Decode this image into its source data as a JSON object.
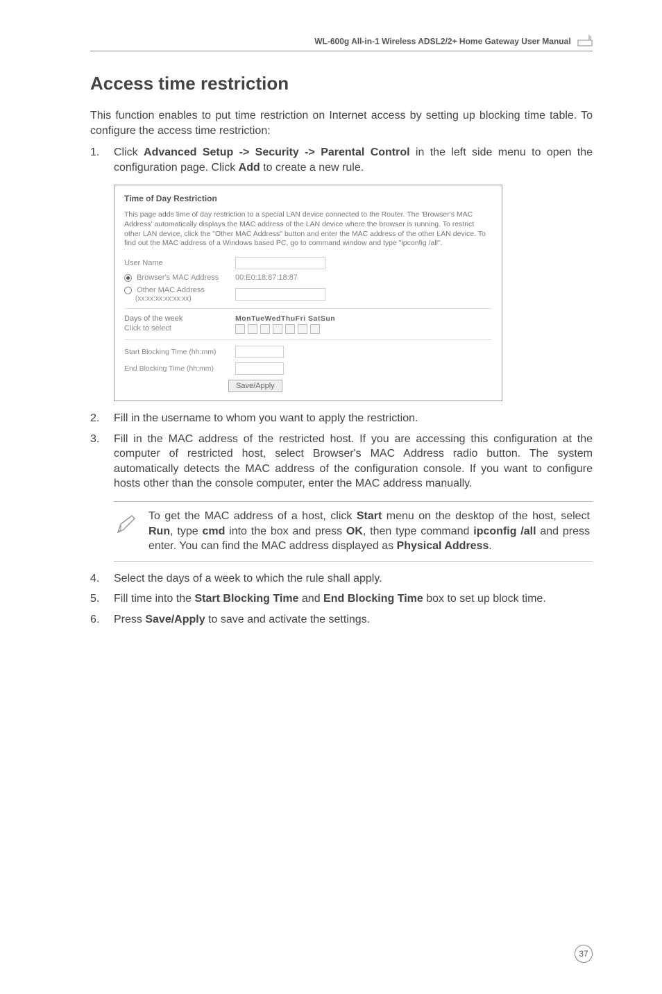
{
  "header": {
    "title": "WL-600g All-in-1 Wireless ADSL2/2+ Home Gateway User Manual"
  },
  "section": {
    "title": "Access time restriction",
    "intro": "This function enables to put time restriction on Internet access by setting up blocking time table. To configure the access time restriction:"
  },
  "steps": {
    "s1_prefix": "Click ",
    "s1_bold": "Advanced Setup -> Security -> Parental Control",
    "s1_mid": " in the left side menu to open the configuration page. Click ",
    "s1_bold2": "Add",
    "s1_suffix": " to create a new rule.",
    "s2": "Fill in the username to whom you want to apply the restriction.",
    "s3": "Fill in the MAC address of the restricted host. If you are accessing this configuration at the computer of restricted host, select Browser's MAC Address radio button. The system automatically detects the MAC address of the configuration console. If you want to configure hosts other than the console computer, enter the MAC address manually.",
    "s4": "Select the days of a week to which the rule shall apply.",
    "s5_prefix": "Fill time into the ",
    "s5_b1": "Start Blocking Time",
    "s5_mid": " and ",
    "s5_b2": "End Blocking Time",
    "s5_suffix": " box to set up block time.",
    "s6_prefix": "Press ",
    "s6_b": "Save/Apply",
    "s6_suffix": " to save and activate the settings."
  },
  "panel": {
    "title": "Time of Day Restriction",
    "desc": "This page adds time of day restriction to a special LAN device connected to the Router. The 'Browser's MAC Address' automatically displays the MAC address of the LAN device where the browser is running. To restrict other LAN device, click the \"Other MAC Address\" button and enter the MAC address of the other LAN device. To find out the MAC address of a Windows based PC, go to command window and type \"ipconfig /all\".",
    "user_name_label": "User Name",
    "radio1_label": "Browser's MAC Address",
    "radio1_value": "00:E0:18:87:18:87",
    "radio2_label": "Other MAC Address",
    "radio2_hint": "(xx:xx:xx:xx:xx:xx)",
    "days_label": "Days of the week",
    "days_header": "MonTueWedThuFri SatSun",
    "click_select": "Click to select",
    "start_label": "Start Blocking Time (hh:mm)",
    "end_label": "End Blocking Time (hh:mm)",
    "button": "Save/Apply"
  },
  "note": {
    "p1": "To get the MAC address of a host, click ",
    "b1": "Start",
    "p2": " menu on the desktop of the host, select ",
    "b2": "Run",
    "p3": ", type ",
    "b3": "cmd",
    "p4": " into the box and press ",
    "b4": "OK",
    "p5": ", then type command ",
    "b5": "ipconfig /all",
    "p6": " and press enter. You can find the MAC address displayed as ",
    "b6": "Physical Address",
    "p7": "."
  },
  "page_number": "37"
}
